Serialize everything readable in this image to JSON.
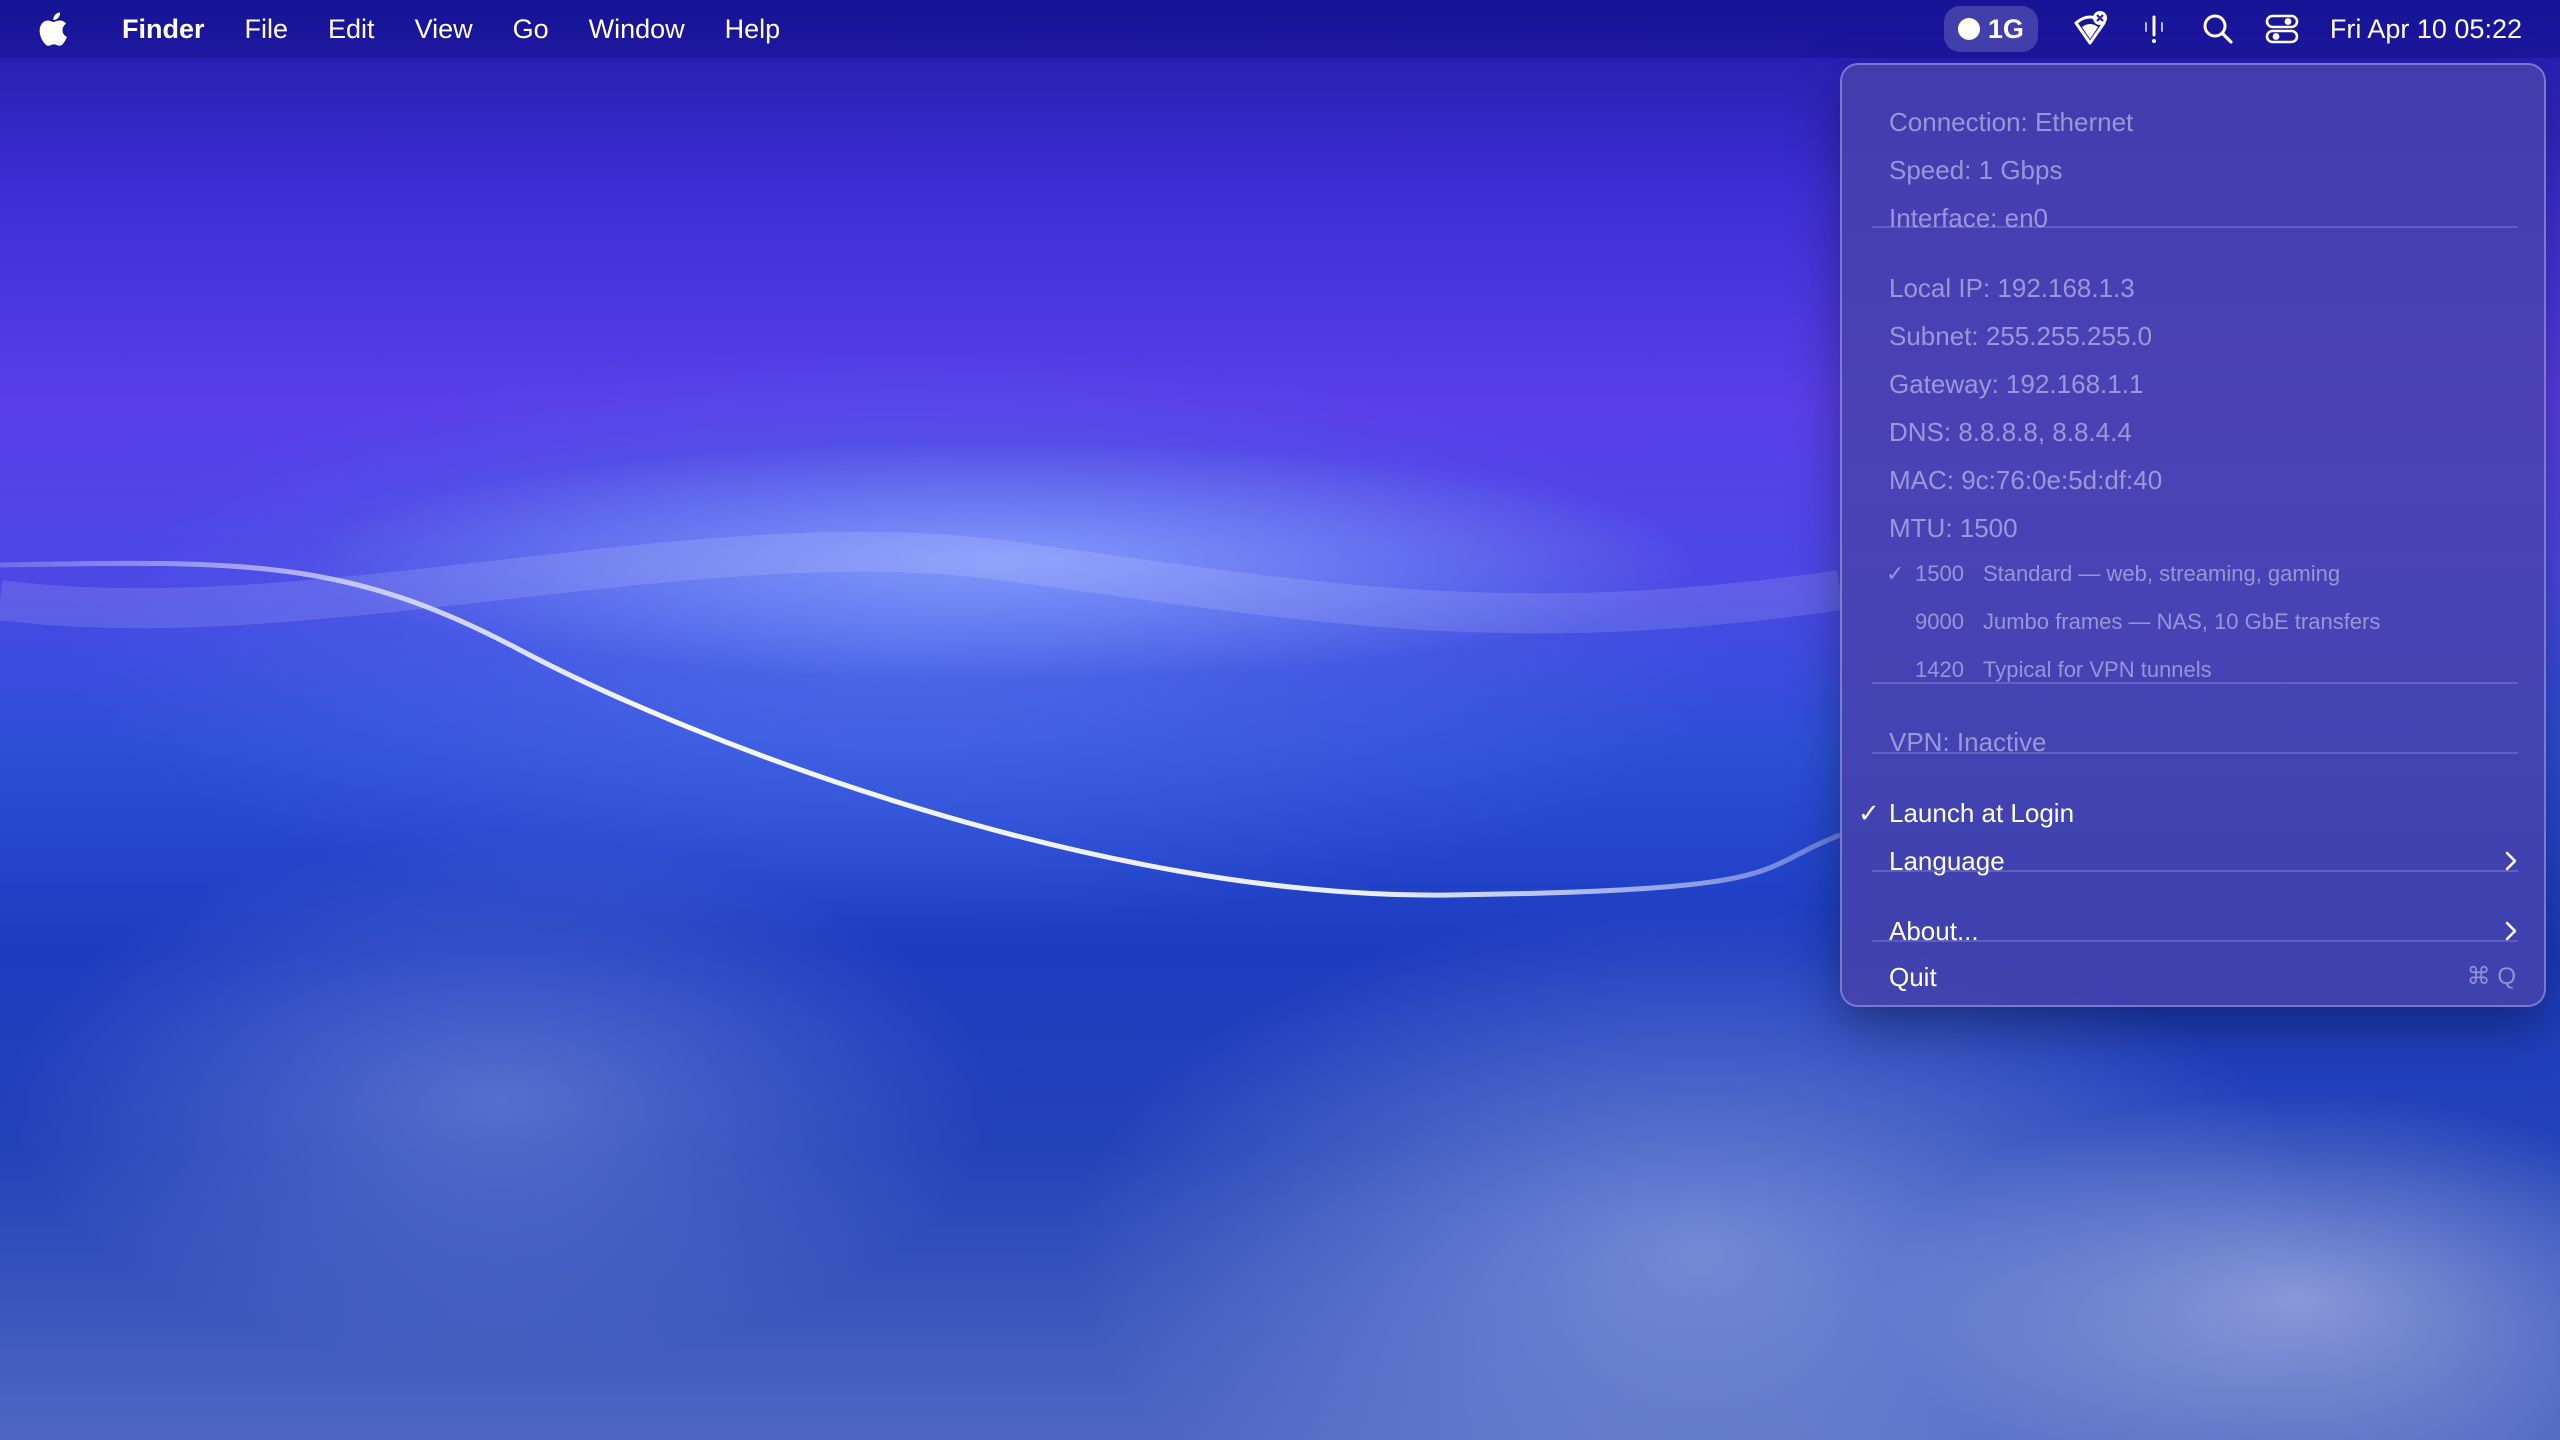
{
  "menubar": {
    "apple_icon": "apple-logo-icon",
    "menus": [
      "Finder",
      "File",
      "Edit",
      "View",
      "Go",
      "Window",
      "Help"
    ],
    "status_item": {
      "label": "1G",
      "icon": "status-dot-icon"
    },
    "icons": [
      "network-error-icon",
      "activity-icon",
      "search-icon",
      "control-center-icon"
    ],
    "clock": "Fri Apr 10  05:22"
  },
  "dropdown": {
    "connection": "Connection: Ethernet",
    "speed": "Speed: 1 Gbps",
    "interface": "Interface: en0",
    "local_ip": "Local IP: 192.168.1.3",
    "subnet": "Subnet: 255.255.255.0",
    "gateway": "Gateway: 192.168.1.1",
    "dns": "DNS: 8.8.8.8, 8.8.4.4",
    "mac": "MAC: 9c:76:0e:5d:df:40",
    "mtu": "MTU: 1500",
    "mtu_options": [
      {
        "value": "1500",
        "description": "Standard — web, streaming, gaming",
        "checked": true
      },
      {
        "value": "9000",
        "description": "Jumbo frames — NAS, 10 GbE transfers",
        "checked": false
      },
      {
        "value": "1420",
        "description": "Typical for VPN tunnels",
        "checked": false
      }
    ],
    "vpn": "VPN: Inactive",
    "launch_at_login": "Launch at Login",
    "launch_at_login_checked": true,
    "language": "Language",
    "about": "About...",
    "quit": "Quit",
    "quit_shortcut": "⌘ Q"
  }
}
